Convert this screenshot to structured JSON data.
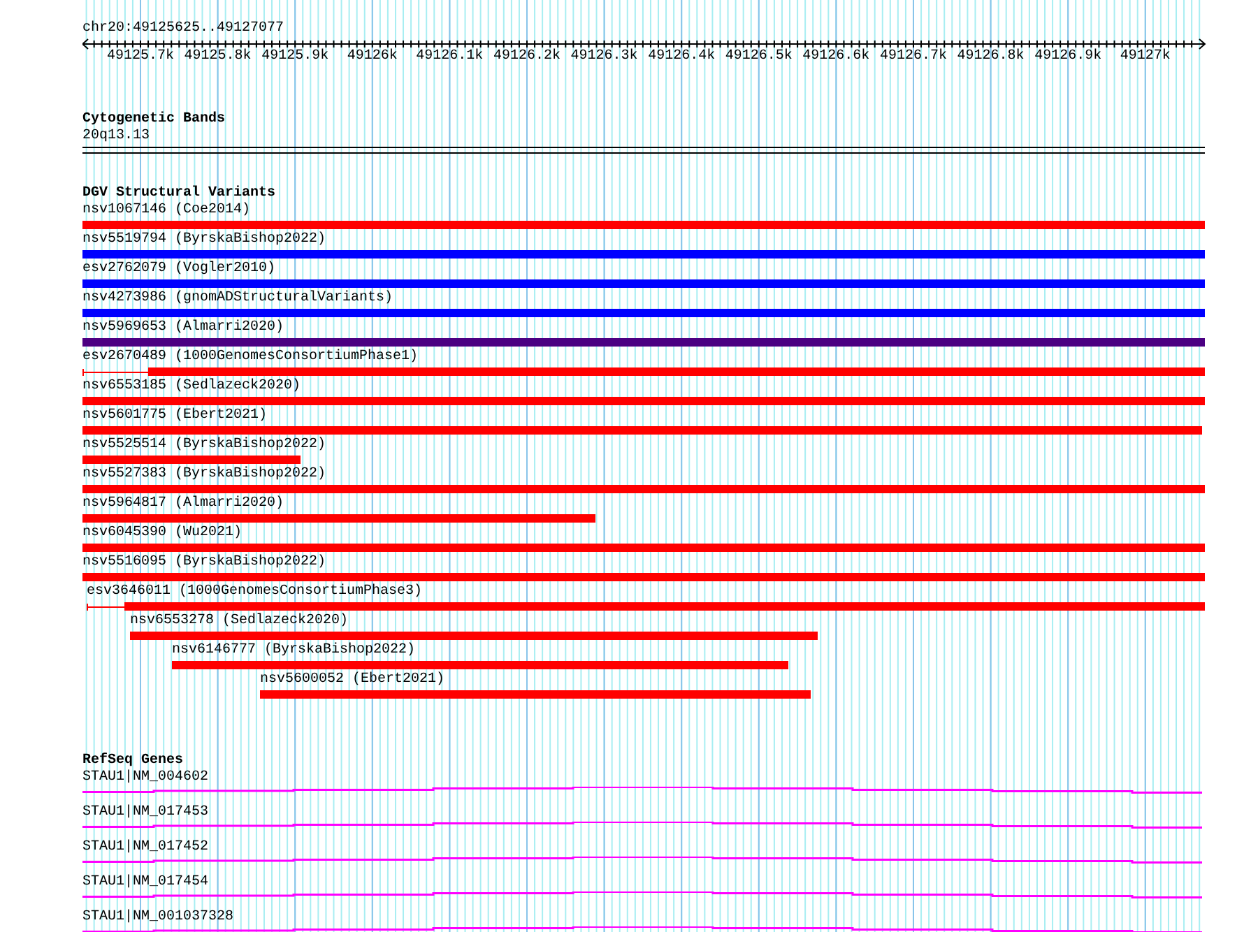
{
  "locus": "chr20:49125625..49127077",
  "ruler": {
    "ticks": [
      "49125.7k",
      "49125.8k",
      "49125.9k",
      "49126k",
      "49126.1k",
      "49126.2k",
      "49126.3k",
      "49126.4k",
      "49126.5k",
      "49126.6k",
      "49126.7k",
      "49126.8k",
      "49126.9k",
      "49127k"
    ]
  },
  "tracks": [
    {
      "kind": "band",
      "title": "Cytogenetic Bands",
      "features": [
        {
          "label": "20q13.13"
        }
      ]
    },
    {
      "kind": "variants",
      "title": "DGV Structural Variants",
      "features": [
        {
          "label": "nsv1067146 (Coe2014)",
          "color": "#ff0000"
        },
        {
          "label": "nsv5519794 (ByrskaBishop2022)",
          "color": "#0000ff"
        },
        {
          "label": "esv2762079 (Vogler2010)",
          "color": "#0000ff"
        },
        {
          "label": "nsv4273986 (gnomADStructuralVariants)",
          "color": "#0000ff"
        },
        {
          "label": "nsv5969653 (Almarri2020)",
          "color": "#4b0082"
        },
        {
          "label": "esv2670489 (1000GenomesConsortiumPhase1)",
          "color": "#ff0000"
        },
        {
          "label": "nsv6553185 (Sedlazeck2020)",
          "color": "#ff0000"
        },
        {
          "label": "nsv5601775 (Ebert2021)",
          "color": "#ff0000"
        },
        {
          "label": "nsv5525514 (ByrskaBishop2022)",
          "color": "#ff0000"
        },
        {
          "label": "nsv5527383 (ByrskaBishop2022)",
          "color": "#ff0000"
        },
        {
          "label": "nsv5964817 (Almarri2020)",
          "color": "#ff0000"
        },
        {
          "label": "nsv6045390 (Wu2021)",
          "color": "#ff0000"
        },
        {
          "label": "nsv5516095 (ByrskaBishop2022)",
          "color": "#ff0000"
        },
        {
          "label": "esv3646011 (1000GenomesConsortiumPhase3)",
          "color": "#ff0000"
        },
        {
          "label": "nsv6553278 (Sedlazeck2020)",
          "color": "#ff0000"
        },
        {
          "label": "nsv6146777 (ByrskaBishop2022)",
          "color": "#ff0000"
        },
        {
          "label": "nsv5600052 (Ebert2021)",
          "color": "#ff0000"
        }
      ]
    },
    {
      "kind": "genes",
      "title": "RefSeq Genes",
      "features": [
        {
          "label": "STAU1|NM_004602"
        },
        {
          "label": "STAU1|NM_017453"
        },
        {
          "label": "STAU1|NM_017452"
        },
        {
          "label": "STAU1|NM_017454"
        },
        {
          "label": "STAU1|NM_001037328"
        }
      ]
    }
  ]
}
